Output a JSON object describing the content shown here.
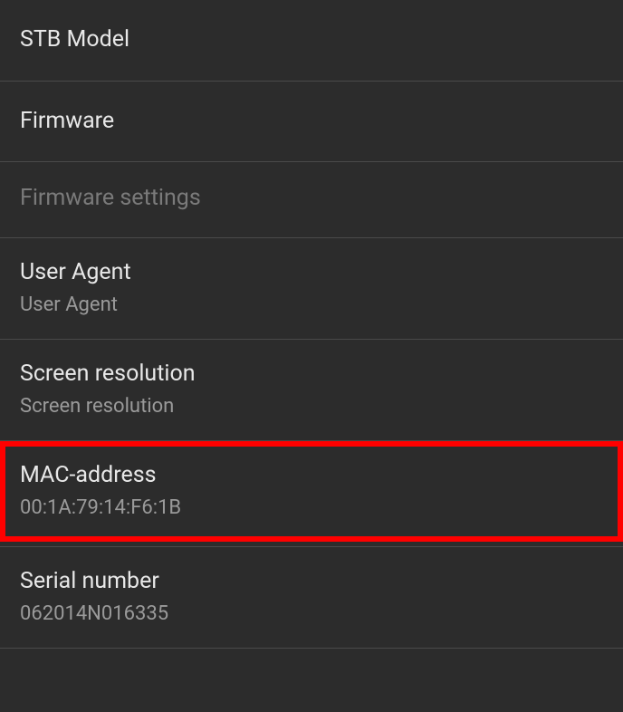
{
  "settings": {
    "stb_model": {
      "title": "STB Model"
    },
    "firmware": {
      "title": "Firmware"
    },
    "firmware_settings": {
      "title": "Firmware settings"
    },
    "user_agent": {
      "title": "User Agent",
      "value": "User Agent"
    },
    "screen_resolution": {
      "title": "Screen resolution",
      "value": "Screen resolution"
    },
    "mac_address": {
      "title": "MAC-address",
      "value": "00:1A:79:14:F6:1B"
    },
    "serial_number": {
      "title": "Serial number",
      "value": "062014N016335"
    }
  }
}
